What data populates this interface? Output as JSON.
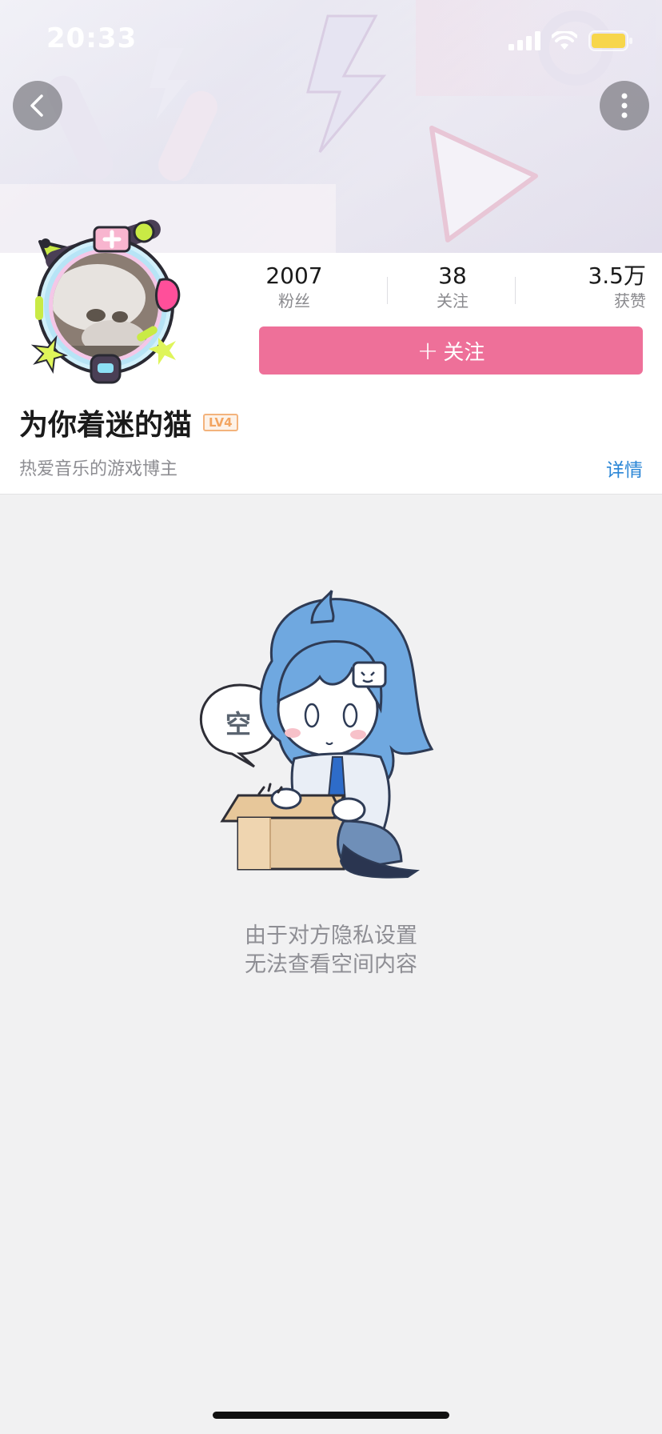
{
  "status_bar": {
    "time": "20:33",
    "signal_icon": "cellular-signal-icon",
    "wifi_icon": "wifi-icon",
    "battery_icon": "battery-icon",
    "battery_color": "#f7d64b"
  },
  "header": {
    "back_icon": "chevron-left-icon",
    "more_icon": "more-vertical-icon"
  },
  "profile": {
    "username": "为你着迷的猫",
    "level": "LV4",
    "bio": "热爱音乐的游戏博主",
    "details_label": "详情",
    "stats": {
      "fans_value": "2007",
      "fans_label": "粉丝",
      "following_value": "38",
      "following_label": "关注",
      "likes_value": "3.5万",
      "likes_label": "获赞"
    },
    "follow_button": {
      "plus": "+",
      "label": "关注"
    }
  },
  "empty_state": {
    "bubble_text": "空",
    "line1": "由于对方隐私设置",
    "line2": "无法查看空间内容"
  },
  "colors": {
    "accent_pink": "#ee7099",
    "link_blue": "#2a86d6",
    "page_bg": "#f1f1f2"
  }
}
